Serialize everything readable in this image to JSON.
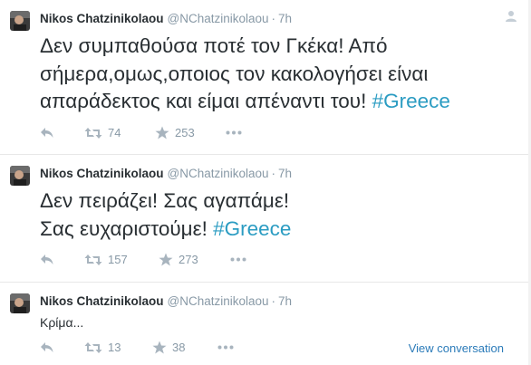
{
  "tweets": [
    {
      "fullname": "Nikos Chatzinikolaou",
      "handle": "@NChatzinikolaou",
      "separator": "·",
      "time": "7h",
      "text": "Δεν συμπαθούσα ποτέ τον Γκέκα! Από σήμερα,ομως,οποιος τον κακολογήσει είναι απαράδεκτος και είμαι απέναντι του! ",
      "hashtag": "#Greece",
      "retweets": "74",
      "favorites": "253",
      "footer_link": ""
    },
    {
      "fullname": "Nikos Chatzinikolaou",
      "handle": "@NChatzinikolaou",
      "separator": "·",
      "time": "7h",
      "text": "Δεν πειράζει! Σας αγαπάμε! Σας ευχαριστούμε! ",
      "hashtag": "#Greece",
      "retweets": "157",
      "favorites": "273",
      "footer_link": ""
    },
    {
      "fullname": "Nikos Chatzinikolaou",
      "handle": "@NChatzinikolaou",
      "separator": "·",
      "time": "7h",
      "text": "Κρίμα...",
      "hashtag": "",
      "retweets": "13",
      "favorites": "38",
      "footer_link": "View conversation"
    }
  ],
  "icons": {
    "reply": "reply-icon",
    "retweet": "retweet-icon",
    "favorite": "star-icon",
    "more": "more-dots-icon",
    "dismiss": "follow-icon"
  },
  "colors": {
    "hashtag": "#2b9cc2",
    "muted": "#8899a6",
    "link": "#2b7bb9"
  }
}
